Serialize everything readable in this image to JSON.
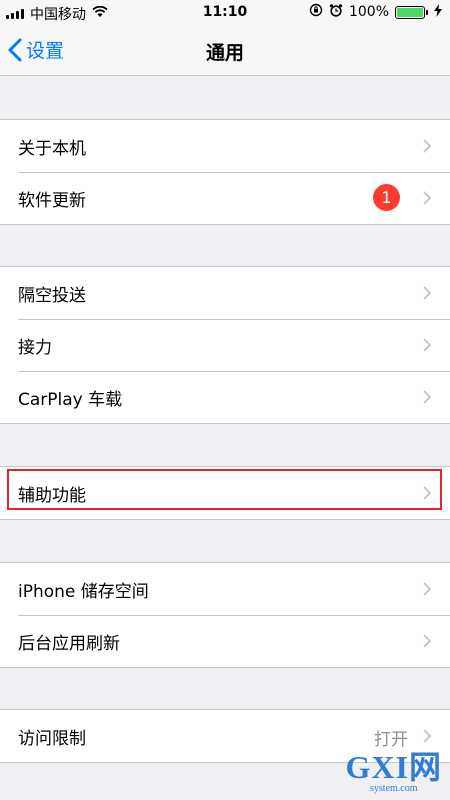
{
  "status_bar": {
    "carrier": "中国移动",
    "time": "11:10",
    "battery": "100%",
    "battery_level": 1.0
  },
  "nav": {
    "back_label": "设置",
    "title": "通用"
  },
  "groups": [
    [
      {
        "label": "关于本机"
      },
      {
        "label": "软件更新",
        "badge": "1"
      }
    ],
    [
      {
        "label": "隔空投送"
      },
      {
        "label": "接力"
      },
      {
        "label": "CarPlay 车载"
      }
    ],
    [
      {
        "label": "辅助功能"
      }
    ],
    [
      {
        "label": "iPhone 储存空间"
      },
      {
        "label": "后台应用刷新"
      }
    ],
    [
      {
        "label": "访问限制",
        "detail": "打开"
      }
    ]
  ],
  "watermark": {
    "main": "GXI网",
    "sub": "system.com"
  }
}
